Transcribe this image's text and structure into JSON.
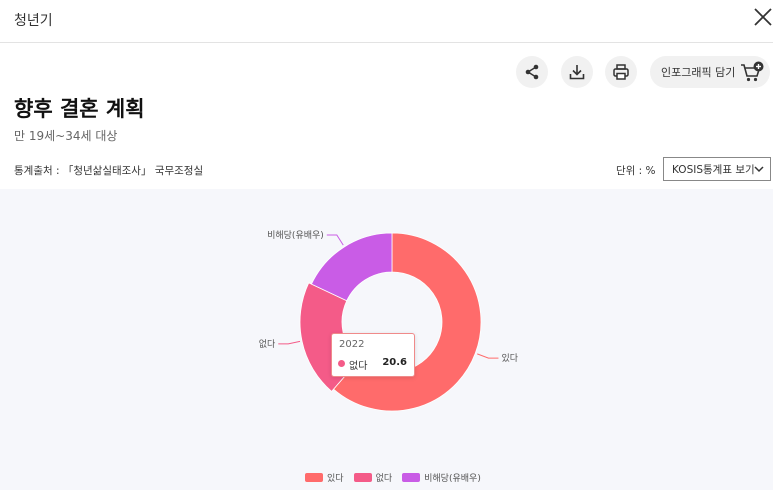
{
  "header": {
    "title": "청년기"
  },
  "toolbar": {
    "infographic_label": "인포그래픽 담기"
  },
  "page": {
    "title": "향후 결혼 계획",
    "subtitle": "만 19세~34세 대상",
    "source": "통계출처 : 「청년삶실태조사」 국무조정실",
    "unit": "단위 : %",
    "kosis_button": "KOSIS통계표 보기"
  },
  "colors": {
    "accent": "#ff6b6b",
    "pink": "#f45b88",
    "purple": "#c95ce6"
  },
  "chart_data": {
    "type": "pie",
    "variant": "donut",
    "year": "2022",
    "categories": [
      "있다",
      "없다",
      "비해당(유배우)"
    ],
    "values": [
      61.4,
      20.6,
      18.0
    ],
    "colors": [
      "#ff6b6b",
      "#f45b88",
      "#c95ce6"
    ],
    "legend_position": "bottom",
    "tooltip": {
      "year": "2022",
      "name": "없다",
      "value": "20.6"
    }
  }
}
